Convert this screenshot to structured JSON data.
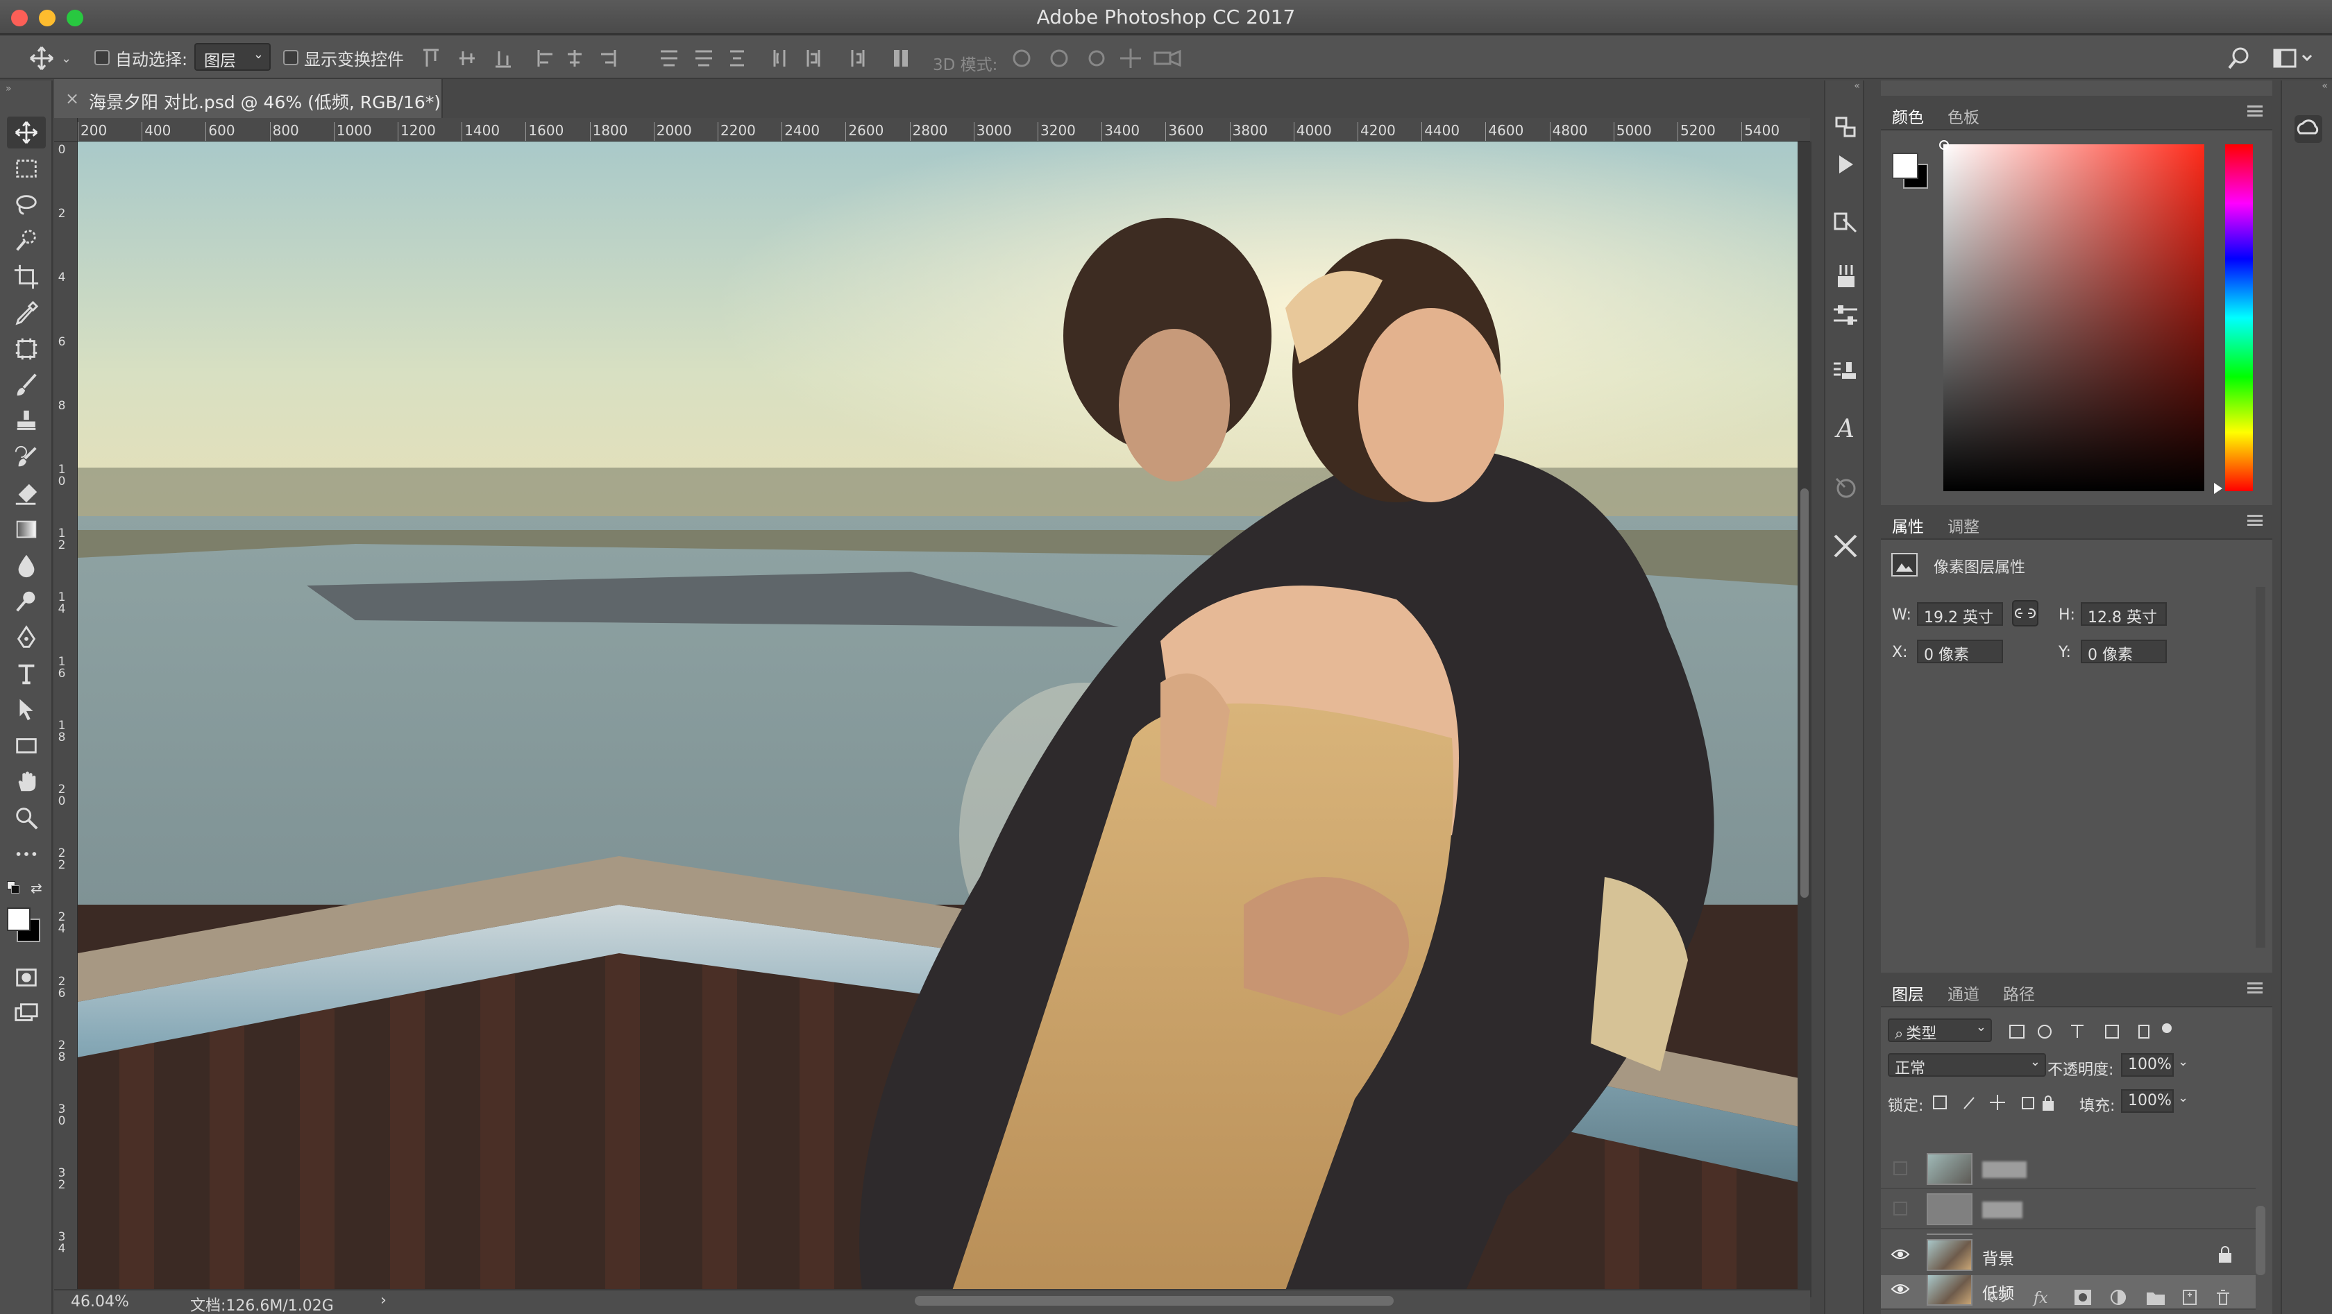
{
  "window": {
    "title": "Adobe Photoshop CC 2017",
    "traffic_lights": [
      "#fc5f57",
      "#fdbc2e",
      "#28c840"
    ]
  },
  "options_bar": {
    "auto_select_label": "自动选择:",
    "auto_select_target": "图层",
    "show_transform_label": "显示变换控件",
    "mode_3d_label": "3D 模式:"
  },
  "document": {
    "tab_title": "海景夕阳 对比.psd @ 46% (低频, RGB/16*) *",
    "close_glyph": "×",
    "ruler_h": [
      "200",
      "400",
      "600",
      "800",
      "1000",
      "1200",
      "1400",
      "1600",
      "1800",
      "2000",
      "2200",
      "2400",
      "2600",
      "2800",
      "3000",
      "3200",
      "3400",
      "3600",
      "3800",
      "4000",
      "4200",
      "4400",
      "4600",
      "4800",
      "5000",
      "5200",
      "5400"
    ],
    "ruler_v": [
      "0",
      "2",
      "4",
      "6",
      "8",
      "10",
      "12",
      "14",
      "16",
      "18",
      "20",
      "22",
      "24",
      "26",
      "28",
      "30",
      "32",
      "34"
    ]
  },
  "status_bar": {
    "zoom": "46.04%",
    "doc_size": "文档:126.6M/1.02G",
    "arrow": "›"
  },
  "tools": [
    "move-tool",
    "marquee-tool",
    "lasso-tool",
    "quick-select-tool",
    "crop-tool",
    "eyedropper-tool",
    "frame-tool",
    "brush-tool",
    "stamp-tool",
    "history-brush-tool",
    "eraser-tool",
    "gradient-tool",
    "blur-tool",
    "dodge-tool",
    "pen-tool",
    "type-tool",
    "path-select-tool",
    "rectangle-tool",
    "hand-tool",
    "zoom-tool",
    "more-tools"
  ],
  "color_panel": {
    "tabs": [
      "颜色",
      "色板"
    ],
    "foreground": "#ffffff",
    "background": "#000000"
  },
  "properties_panel": {
    "tabs": [
      "属性",
      "调整"
    ],
    "heading": "像素图层属性",
    "w_label": "W:",
    "w_value": "19.2 英寸",
    "h_label": "H:",
    "h_value": "12.8 英寸",
    "x_label": "X:",
    "x_value": "0 像素",
    "y_label": "Y:",
    "y_value": "0 像素"
  },
  "layers_panel": {
    "tabs": [
      "图层",
      "通道",
      "路径"
    ],
    "filter_label": "类型",
    "blend_mode": "正常",
    "opacity_label": "不透明度:",
    "opacity_value": "100%",
    "lock_label": "锁定:",
    "fill_label": "填充:",
    "fill_value": "100%",
    "layers": [
      {
        "name": "",
        "visible": false,
        "selected": false
      },
      {
        "name": "",
        "visible": false,
        "selected": false
      },
      {
        "name": "",
        "visible": false,
        "selected": false
      },
      {
        "name": "低频",
        "visible": true,
        "selected": true
      },
      {
        "name": "背景",
        "visible": true,
        "selected": false,
        "locked": true
      }
    ],
    "footer_icons": [
      "link-icon",
      "fx-icon",
      "mask-icon",
      "adjustment-icon",
      "group-icon",
      "new-layer-icon",
      "trash-icon"
    ]
  }
}
